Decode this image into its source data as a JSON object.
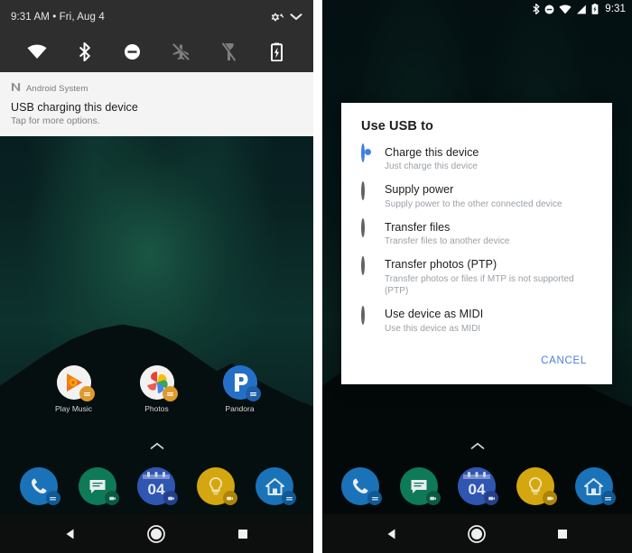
{
  "left_phone": {
    "shade": {
      "clock": "9:31 AM • Fri, Aug 4",
      "settings_icon": "gear-wrench-icon",
      "expand_icon": "chevron-down-icon",
      "quick_settings": [
        {
          "name": "wifi",
          "label": "Wi-Fi",
          "active": true
        },
        {
          "name": "bluetooth",
          "label": "Bluetooth",
          "active": true
        },
        {
          "name": "do-not-disturb",
          "label": "Do Not Disturb",
          "active": true
        },
        {
          "name": "airplane-mode",
          "label": "Airplane mode",
          "active": false
        },
        {
          "name": "flashlight",
          "label": "Flashlight",
          "active": false
        },
        {
          "name": "battery-saver",
          "label": "Battery Saver",
          "active": true
        }
      ]
    },
    "notification": {
      "app_icon": "android-system-icon",
      "app_name": "Android System",
      "title": "USB charging this device",
      "body": "Tap for more options."
    },
    "apps": [
      {
        "name": "play-music",
        "label": "Play Music",
        "color": "#f2f2f2"
      },
      {
        "name": "photos",
        "label": "Photos",
        "color": "#f2f2f2"
      },
      {
        "name": "pandora",
        "label": "Pandora",
        "color": "#2470c8"
      }
    ],
    "drawer_handle_icon": "chevron-up-icon"
  },
  "right_phone": {
    "statusbar": {
      "time": "9:31",
      "icons": [
        "bluetooth-icon",
        "do-not-disturb-icon",
        "wifi-icon",
        "signal-icon",
        "battery-charging-icon"
      ]
    },
    "dialog": {
      "title": "Use USB to",
      "options": [
        {
          "label": "Charge this device",
          "sub": "Just charge this device",
          "selected": true
        },
        {
          "label": "Supply power",
          "sub": "Supply power to the other connected device",
          "selected": false
        },
        {
          "label": "Transfer files",
          "sub": "Transfer files to another device",
          "selected": false
        },
        {
          "label": "Transfer photos (PTP)",
          "sub": "Transfer photos or files if MTP is not supported (PTP)",
          "selected": false
        },
        {
          "label": "Use device as MIDI",
          "sub": "Use this device as MIDI",
          "selected": false
        }
      ],
      "cancel_label": "CANCEL"
    },
    "drawer_handle_icon": "chevron-up-icon"
  },
  "dock": [
    {
      "name": "phone",
      "label": "Phone",
      "color": "#1a73b8"
    },
    {
      "name": "messages",
      "label": "Messages",
      "color": "#0f7a57"
    },
    {
      "name": "calendar",
      "label": "Calendar",
      "color": "#2f56b0",
      "day": "04"
    },
    {
      "name": "keep",
      "label": "Keep",
      "color": "#d4a710"
    },
    {
      "name": "home",
      "label": "Home",
      "color": "#1a73b8"
    }
  ],
  "navbar": [
    {
      "name": "back",
      "label": "Back",
      "icon": "triangle-back-icon"
    },
    {
      "name": "home",
      "label": "Home",
      "icon": "circle-home-icon"
    },
    {
      "name": "recents",
      "label": "Recents",
      "icon": "square-recents-icon"
    }
  ],
  "colors": {
    "accent_blue": "#4285f4",
    "shade_bg": "#2e2e2e",
    "notif_bg": "#f4f4f4",
    "navbar_bg": "#0d0f0e"
  }
}
